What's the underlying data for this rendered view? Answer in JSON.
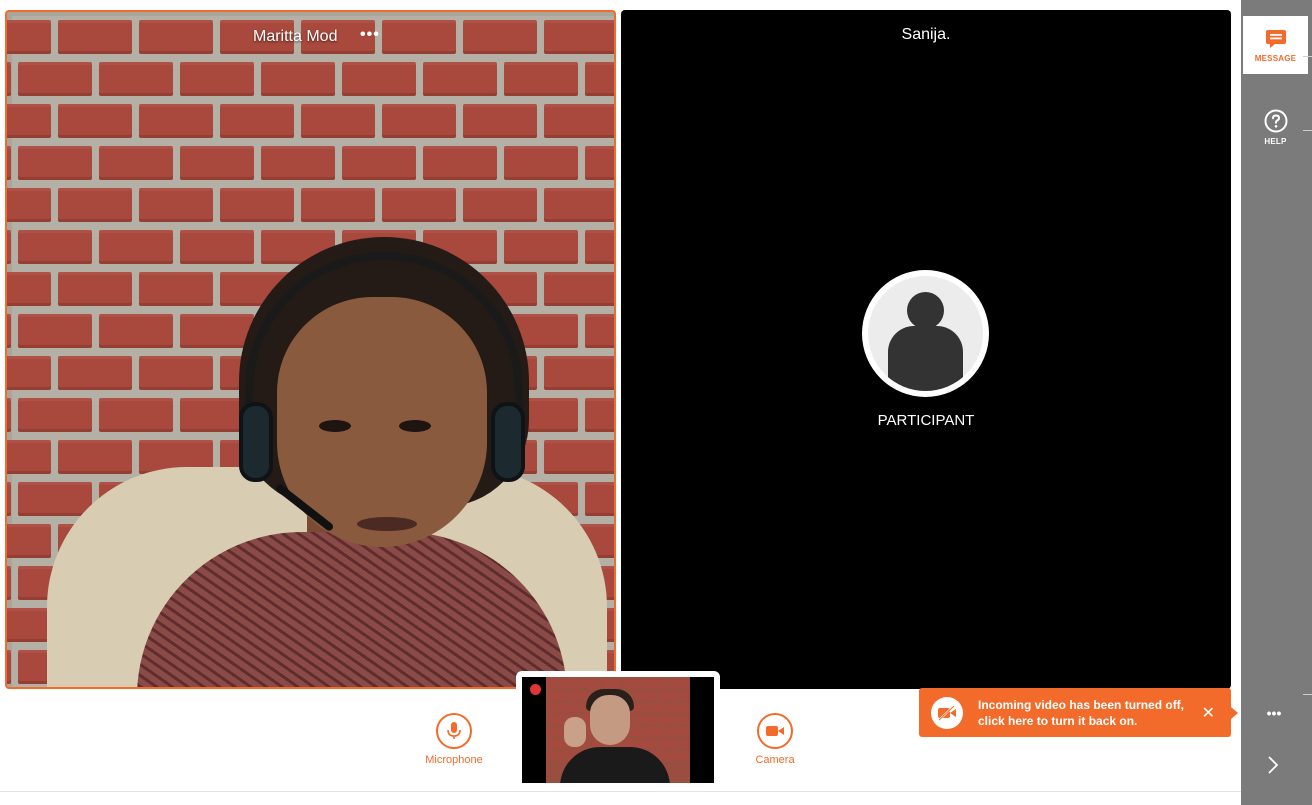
{
  "participants": [
    {
      "name": "Maritta Mod",
      "more_label": "•••"
    },
    {
      "name": "Sanija.",
      "role_label": "PARTICIPANT"
    }
  ],
  "sidebar": {
    "message_label": "MESSAGE",
    "help_label": "HELP",
    "more_label": "•••"
  },
  "controls": {
    "microphone_label": "Microphone",
    "camera_label": "Camera"
  },
  "notification": {
    "text": "Incoming video has been turned off, click here to turn it back on.",
    "close_label": "✕"
  },
  "colors": {
    "accent": "#f26b2a",
    "rail": "#7b7b7b",
    "recording": "#e03636"
  },
  "icons": [
    "more-icon",
    "message-icon",
    "help-icon",
    "chevron-right-icon",
    "microphone-icon",
    "camera-icon",
    "video-off-icon",
    "close-icon",
    "avatar-icon",
    "recording-indicator"
  ]
}
